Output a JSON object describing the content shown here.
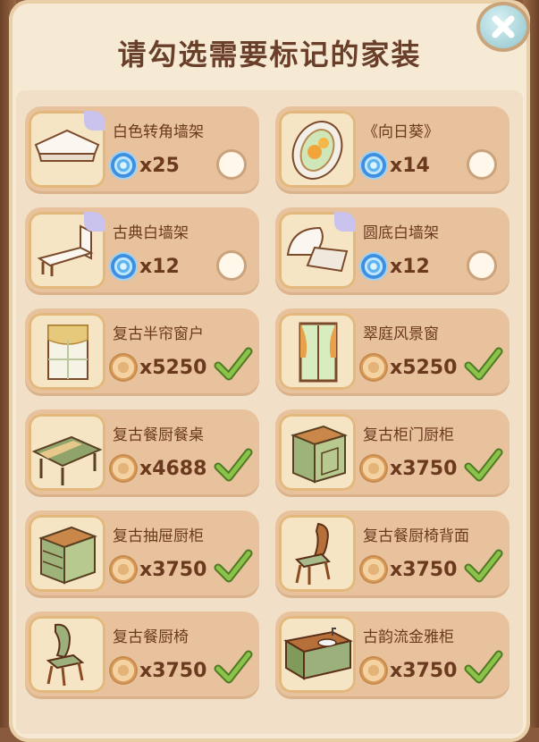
{
  "header": {
    "title": "请勾选需要标记的家装"
  },
  "colors": {
    "accent_check": "#7cb342",
    "currency_blue": "#4a97e3",
    "currency_gold": "#d9a25c",
    "card_bg": "#e7c29d",
    "panel_bg": "#f7ead5"
  },
  "items": [
    {
      "name": "白色转角墙架",
      "currency": "blue-swirl-icon",
      "price": "x25",
      "checked": false,
      "tagged": true,
      "icon": "corner-shelf"
    },
    {
      "name": "《向日葵》",
      "currency": "blue-swirl-icon",
      "price": "x14",
      "checked": false,
      "tagged": false,
      "icon": "sunflower-plate"
    },
    {
      "name": "古典白墙架",
      "currency": "blue-swirl-icon",
      "price": "x12",
      "checked": false,
      "tagged": true,
      "icon": "classic-shelf"
    },
    {
      "name": "圆底白墙架",
      "currency": "blue-swirl-icon",
      "price": "x12",
      "checked": false,
      "tagged": true,
      "icon": "round-shelf"
    },
    {
      "name": "复古半帘窗户",
      "currency": "gold-coin-icon",
      "price": "x5250",
      "checked": true,
      "tagged": false,
      "icon": "half-curtain-window"
    },
    {
      "name": "翠庭风景窗",
      "currency": "gold-coin-icon",
      "price": "x5250",
      "checked": true,
      "tagged": false,
      "icon": "scenery-window"
    },
    {
      "name": "复古餐厨餐桌",
      "currency": "gold-coin-icon",
      "price": "x4688",
      "checked": true,
      "tagged": false,
      "icon": "dining-table"
    },
    {
      "name": "复古柜门厨柜",
      "currency": "gold-coin-icon",
      "price": "x3750",
      "checked": true,
      "tagged": false,
      "icon": "door-cabinet"
    },
    {
      "name": "复古抽屉厨柜",
      "currency": "gold-coin-icon",
      "price": "x3750",
      "checked": true,
      "tagged": false,
      "icon": "drawer-cabinet"
    },
    {
      "name": "复古餐厨椅背面",
      "currency": "gold-coin-icon",
      "price": "x3750",
      "checked": true,
      "tagged": false,
      "icon": "chair-back"
    },
    {
      "name": "复古餐厨椅",
      "currency": "gold-coin-icon",
      "price": "x3750",
      "checked": true,
      "tagged": false,
      "icon": "dining-chair"
    },
    {
      "name": "古韵流金雅柜",
      "currency": "gold-coin-icon",
      "price": "x3750",
      "checked": true,
      "tagged": false,
      "icon": "sink-cabinet"
    }
  ]
}
